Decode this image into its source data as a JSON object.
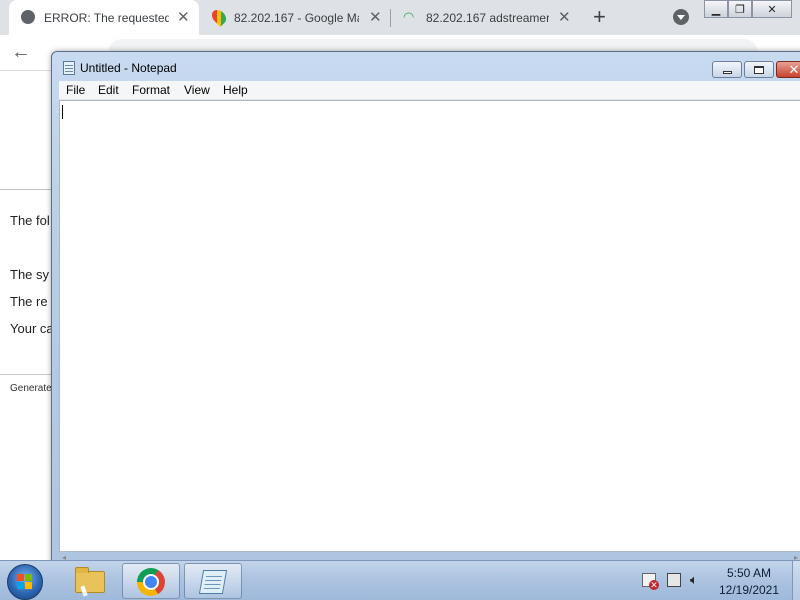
{
  "browser": {
    "tabs": [
      {
        "title": "ERROR: The requested",
        "active": true,
        "icon": "globe-icon"
      },
      {
        "title": "82.202.167 - Google Ma",
        "active": false,
        "icon": "google-maps-pin-icon"
      },
      {
        "title": "82.202.167 adstreamer",
        "active": false,
        "icon": "wifi-icon"
      }
    ],
    "new_tab_label": "+",
    "page_lines": [
      "The fol",
      "The sy",
      "The re",
      "Your ca"
    ],
    "footer_text": "Generate"
  },
  "notepad": {
    "title": "Untitled - Notepad",
    "menu": [
      "File",
      "Edit",
      "Format",
      "View",
      "Help"
    ],
    "content": ""
  },
  "taskbar": {
    "clock_time": "5:50 AM",
    "clock_date": "12/19/2021",
    "apps": [
      "file-explorer",
      "google-chrome",
      "notepad"
    ]
  },
  "colors": {
    "taskbar": "#adc4e1",
    "chrome_tabstrip": "#dee1e6",
    "notepad_frame": "#b8cde6"
  }
}
